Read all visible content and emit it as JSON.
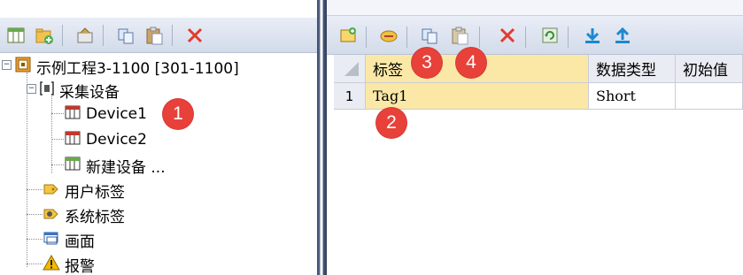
{
  "tree": {
    "project": "示例工程3-1100 [301-1100]",
    "collect_group": "采集设备",
    "device1": "Device1",
    "device2": "Device2",
    "new_device": "新建设备 ...",
    "user_tags": "用户标签",
    "system_tags": "系统标签",
    "screens": "画面",
    "alarms": "报警"
  },
  "grid": {
    "headers": [
      "标签",
      "数据类型",
      "初始值"
    ],
    "rows": [
      {
        "num": "1",
        "name": "Tag1",
        "type": "Short",
        "init": ""
      }
    ]
  },
  "badges": [
    "1",
    "2",
    "3",
    "4"
  ],
  "colors": {
    "badge": "#e8413a",
    "selection": "#fbe8a6",
    "toolbar": "#dde3ef"
  }
}
